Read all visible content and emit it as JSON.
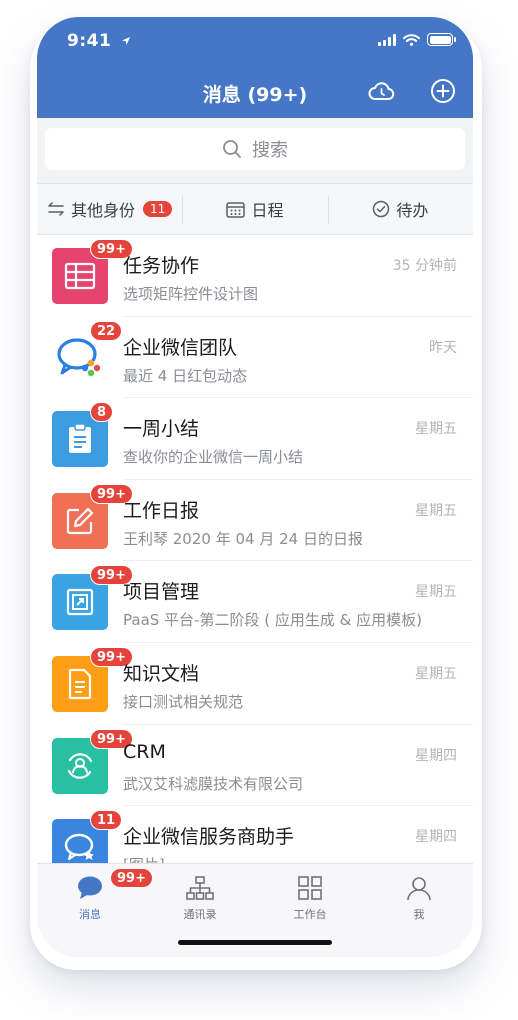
{
  "status": {
    "time": "9:41"
  },
  "header": {
    "title": "消息 (99+)"
  },
  "search": {
    "placeholder": "搜索"
  },
  "tabs": [
    {
      "label": "其他身份",
      "badge": "11"
    },
    {
      "label": "日程"
    },
    {
      "label": "待办"
    }
  ],
  "messages": [
    {
      "name": "任务协作",
      "preview": "选项矩阵控件设计图",
      "time": "35 分钟前",
      "badge": "99+",
      "color": "#e6436e",
      "icon": "grid-icon"
    },
    {
      "name": "企业微信团队",
      "preview": "最近 4 日红包动态",
      "time": "昨天",
      "badge": "22",
      "color": "#ffffff",
      "icon": "wecom-logo-icon"
    },
    {
      "name": "一周小结",
      "preview": "查收你的企业微信一周小结",
      "time": "星期五",
      "badge": "8",
      "color": "#3d9be0",
      "icon": "clipboard-icon"
    },
    {
      "name": "工作日报",
      "preview": "王利琴 2020 年 04 月 24 日的日报",
      "time": "星期五",
      "badge": "99+",
      "color": "#f07055",
      "icon": "edit-icon"
    },
    {
      "name": "项目管理",
      "preview": "PaaS 平台-第二阶段 ( 应用生成 & 应用模板)",
      "time": "星期五",
      "badge": "99+",
      "color": "#39a3e4",
      "icon": "project-icon"
    },
    {
      "name": "知识文档",
      "preview": "接口测试相关规范",
      "time": "星期五",
      "badge": "99+",
      "color": "#ff9d14",
      "icon": "document-icon"
    },
    {
      "name": "CRM",
      "preview": "武汉艾科滤膜技术有限公司",
      "time": "星期四",
      "badge": "99+",
      "color": "#28bfa3",
      "icon": "crm-icon"
    },
    {
      "name": "企业微信服务商助手",
      "preview": "[图片]",
      "time": "星期四",
      "badge": "11",
      "color": "#3a86df",
      "icon": "service-chat-icon"
    }
  ],
  "tabbar": [
    {
      "label": "消息",
      "badge": "99+"
    },
    {
      "label": "通讯录"
    },
    {
      "label": "工作台"
    },
    {
      "label": "我"
    }
  ],
  "colors": {
    "header": "#4676c6",
    "badge": "#e4443c"
  }
}
